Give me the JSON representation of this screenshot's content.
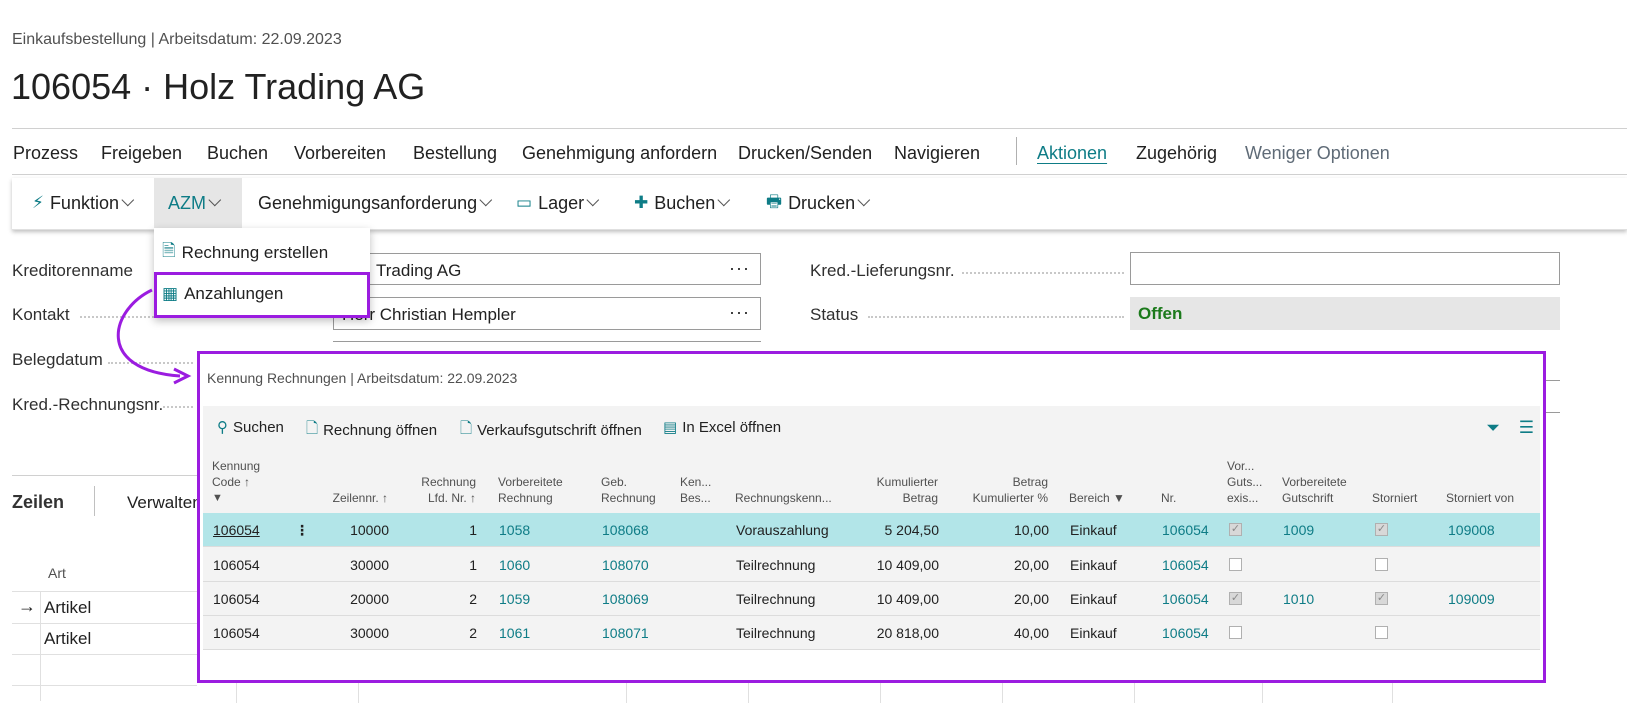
{
  "header": {
    "breadcrumb": "Einkaufsbestellung | Arbeitsdatum: 22.09.2023",
    "title": "106054 · Holz Trading AG"
  },
  "nav": {
    "items": [
      "Prozess",
      "Freigeben",
      "Buchen",
      "Vorbereiten",
      "Bestellung",
      "Genehmigung anfordern",
      "Drucken/Senden",
      "Navigieren",
      "Aktionen",
      "Zugehörig",
      "Weniger Optionen"
    ]
  },
  "actions": {
    "funktion": "Funktion",
    "azm": "AZM",
    "genehmigung": "Genehmigungsanforderung",
    "lager": "Lager",
    "buchen": "Buchen",
    "drucken": "Drucken"
  },
  "dropdown": {
    "items": [
      "Rechnung erstellen",
      "Anzahlungen"
    ]
  },
  "form": {
    "kreditorenname_label": "Kreditorenname",
    "kreditorenname_value": "Trading AG",
    "kontakt_label": "Kontakt",
    "kontakt_value": "Herr Christian Hempler",
    "belegdatum_label": "Belegdatum",
    "kred_rechnungsnr_label": "Kred.-Rechnungsnr.",
    "kred_lieferungsnr_label": "Kred.-Lieferungsnr.",
    "kred_lieferungsnr_value": "",
    "status_label": "Status",
    "status_value": "Offen",
    "more_glyph": "···"
  },
  "lines": {
    "title": "Zeilen",
    "verwalten": "Verwalten",
    "col_art": "Art",
    "rows": [
      "Artikel",
      "Artikel"
    ]
  },
  "panel": {
    "title": "Kennung Rechnungen | Arbeitsdatum: 22.09.2023",
    "toolbar": [
      "Suchen",
      "Rechnung öffnen",
      "Verkaufsgutschrift öffnen",
      "In Excel öffnen"
    ],
    "columns": {
      "kennung": [
        "Kennung",
        "Code ↑"
      ],
      "zeilennr": "Zeilennr. ↑",
      "rechnung_lfd": [
        "Rechnung",
        "Lfd. Nr. ↑"
      ],
      "vorb_rechnung": [
        "Vorbereitete",
        "Rechnung"
      ],
      "geb_rechnung": [
        "Geb.",
        "Rechnung"
      ],
      "ken_bes": [
        "Ken...",
        "Bes..."
      ],
      "rechnungskenn": "Rechnungskenn...",
      "kum_betrag": [
        "Kumulierter",
        "Betrag"
      ],
      "betrag_kum": [
        "Betrag",
        "Kumulierter %"
      ],
      "bereich": "Bereich",
      "nr": "Nr.",
      "vor_guts": [
        "Vor...",
        "Guts...",
        "exis..."
      ],
      "vorb_gutschrift": [
        "Vorbereitete",
        "Gutschrift"
      ],
      "storniert": "Storniert",
      "storniert_von": "Storniert von"
    },
    "rows": [
      {
        "kennung": "106054",
        "zeilennr": "10000",
        "lfd": "1",
        "vorb": "1058",
        "geb": "108068",
        "kenn": "Vorauszahlung",
        "betrag": "5 204,50",
        "prozent": "10,00",
        "bereich": "Einkauf",
        "nr": "106054",
        "guts_exists": true,
        "vorb_guts": "1009",
        "storniert": true,
        "storniert_von": "109008"
      },
      {
        "kennung": "106054",
        "zeilennr": "30000",
        "lfd": "1",
        "vorb": "1060",
        "geb": "108070",
        "kenn": "Teilrechnung",
        "betrag": "10 409,00",
        "prozent": "20,00",
        "bereich": "Einkauf",
        "nr": "106054",
        "guts_exists": false,
        "vorb_guts": "",
        "storniert": false,
        "storniert_von": ""
      },
      {
        "kennung": "106054",
        "zeilennr": "20000",
        "lfd": "2",
        "vorb": "1059",
        "geb": "108069",
        "kenn": "Teilrechnung",
        "betrag": "10 409,00",
        "prozent": "20,00",
        "bereich": "Einkauf",
        "nr": "106054",
        "guts_exists": true,
        "vorb_guts": "1010",
        "storniert": true,
        "storniert_von": "109009"
      },
      {
        "kennung": "106054",
        "zeilennr": "30000",
        "lfd": "2",
        "vorb": "1061",
        "geb": "108071",
        "kenn": "Teilrechnung",
        "betrag": "20 818,00",
        "prozent": "40,00",
        "bereich": "Einkauf",
        "nr": "106054",
        "guts_exists": false,
        "vorb_guts": "",
        "storniert": false,
        "storniert_von": ""
      }
    ]
  },
  "colors": {
    "accent": "#0e7c86",
    "highlight_border": "#9b1ce0",
    "selected_row": "#b2e5e8",
    "status_ok": "#1c7a1c"
  }
}
